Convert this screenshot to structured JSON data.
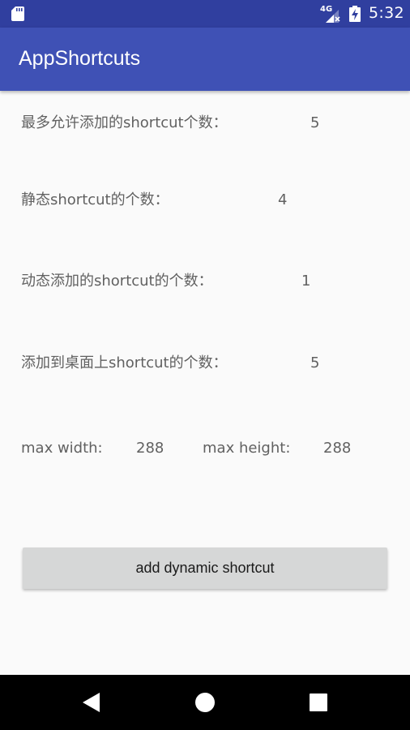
{
  "status_bar": {
    "time": "5:32",
    "network_label": "4G",
    "icons": [
      "sd-card-icon",
      "signal-icon",
      "battery-charging-icon"
    ]
  },
  "app_bar": {
    "title": "AppShortcuts"
  },
  "stats": {
    "max_allowed_label": "最多允许添加的shortcut个数：",
    "max_allowed_value": "5",
    "static_label": "静态shortcut的个数：",
    "static_value": "4",
    "dynamic_label": "动态添加的shortcut的个数：",
    "dynamic_value": "1",
    "pinned_label": "添加到桌面上shortcut的个数：",
    "pinned_value": "5",
    "max_width_label": "max width:",
    "max_width_value": "288",
    "max_height_label": "max height:",
    "max_height_value": "288"
  },
  "actions": {
    "add_dynamic_label": "add dynamic shortcut"
  },
  "nav_bar": {
    "icons": [
      "back-icon",
      "home-icon",
      "recents-icon"
    ]
  },
  "colors": {
    "status_bar": "#303f9f",
    "app_bar": "#3f51b5",
    "background": "#fafafa",
    "button": "#d6d7d7",
    "text": "#616161"
  }
}
